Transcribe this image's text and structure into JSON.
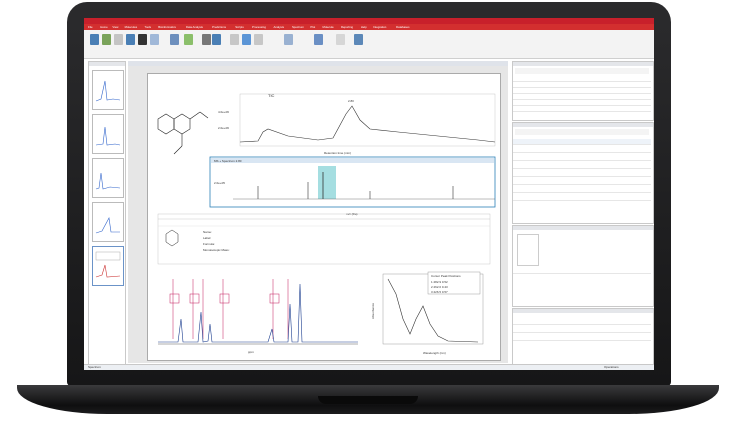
{
  "ribbon": {
    "tabs": [
      "File",
      "Home",
      "View",
      "Molecules",
      "Tools",
      "Bioinformatics",
      "Data Analysis",
      "Predictions",
      "Scripts",
      "Processing",
      "Analysis",
      "Spectrum",
      "Plot",
      "Molecule",
      "Reporting",
      "Help",
      "Integration",
      "Databases"
    ]
  },
  "document": {
    "title": "TIC",
    "ms_title": "MS + Spectrum 2.80",
    "ms_x_label": "m/z (Da)",
    "ms_ticks": [
      "180",
      "190",
      "200",
      "210",
      "220",
      "230",
      "240",
      "250",
      "260",
      "270",
      "280",
      "290",
      "300"
    ],
    "tic_ticks": [
      "0.5",
      "1.0",
      "1.5",
      "2.0",
      "2.5",
      "3.0",
      "3.5",
      "4.0"
    ],
    "tic_xlabel": "Retention time (min)",
    "tic_ylabel": "4.0e+06",
    "tic_y2": "2.0e+06",
    "ms_y": "2.0e+05",
    "nmr_xlabel": "ppm",
    "nmr_ticks": [
      "10",
      "9",
      "8",
      "7",
      "6",
      "5",
      "4",
      "3",
      "2",
      "1",
      "0"
    ],
    "uv_ylabel": "Absorbance",
    "uv_xlabel": "Wavelength (nm)",
    "uv_ticks": [
      "200",
      "250",
      "300",
      "350",
      "400"
    ],
    "uv_box": [
      "Cursor Peak Positions",
      "1 282.9 0.52",
      "2 262.0 0.43",
      "3 226.5 0.57"
    ],
    "table_headers": [
      "Molecule",
      "Molecule Data",
      "Match",
      "Match Score",
      "Similarity",
      "MW(calc)",
      "RT",
      "Area",
      "Purity",
      "Adduct Ions",
      "Error (ppm)",
      "Error (mDa)",
      "Predicted Mass",
      "Measured m/z"
    ],
    "molecule_data": [
      "Name:",
      "Label:",
      "Formula:",
      "Monoisotopic Mass:"
    ]
  },
  "status": {
    "left": "Spectrum",
    "right": "Operations"
  }
}
